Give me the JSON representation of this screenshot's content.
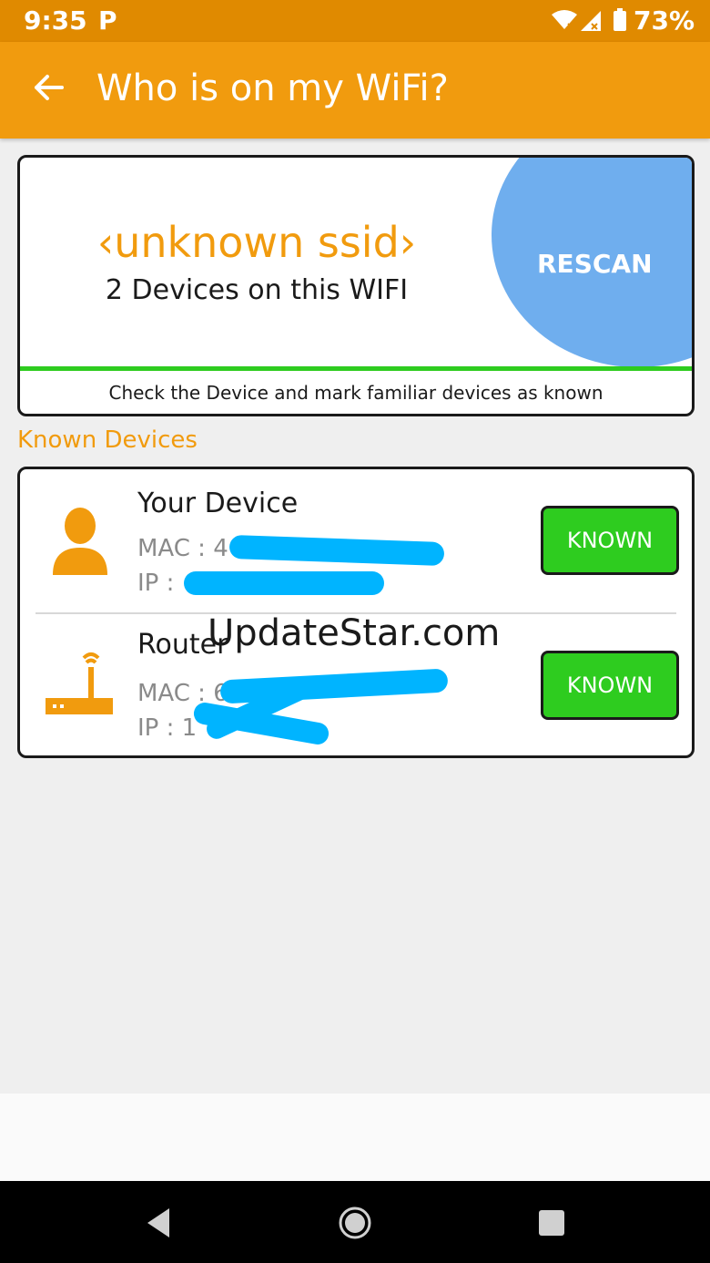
{
  "status_bar": {
    "time": "9:35",
    "notification_icon": "parking-icon",
    "p_badge": "P",
    "battery_percent": "73%"
  },
  "app_bar": {
    "title": "Who is on my WiFi?",
    "back_icon": "arrow-left-icon"
  },
  "network_card": {
    "ssid": "‹unknown ssid›",
    "device_count_text": "2 Devices on this WIFI",
    "rescan_label": "RESCAN",
    "hint": "Check the Device and mark familiar devices as known"
  },
  "known_devices": {
    "header": "Known Devices",
    "devices": [
      {
        "name": "Your Device",
        "mac_label": "MAC : 4",
        "ip_label": "IP :",
        "icon": "person-icon",
        "button_label": "KNOWN"
      },
      {
        "name": "Router",
        "mac_label": "MAC : 6",
        "ip_label": "IP : 1",
        "icon": "router-icon",
        "button_label": "KNOWN"
      }
    ]
  },
  "watermark": "UpdateStar.com",
  "colors": {
    "status_bar": "#e08a00",
    "app_bar": "#f19b0e",
    "accent_orange": "#f19b0e",
    "rescan_blue": "#6faeee",
    "known_green": "#2ecc1f",
    "redaction_blue": "#00b4ff"
  }
}
